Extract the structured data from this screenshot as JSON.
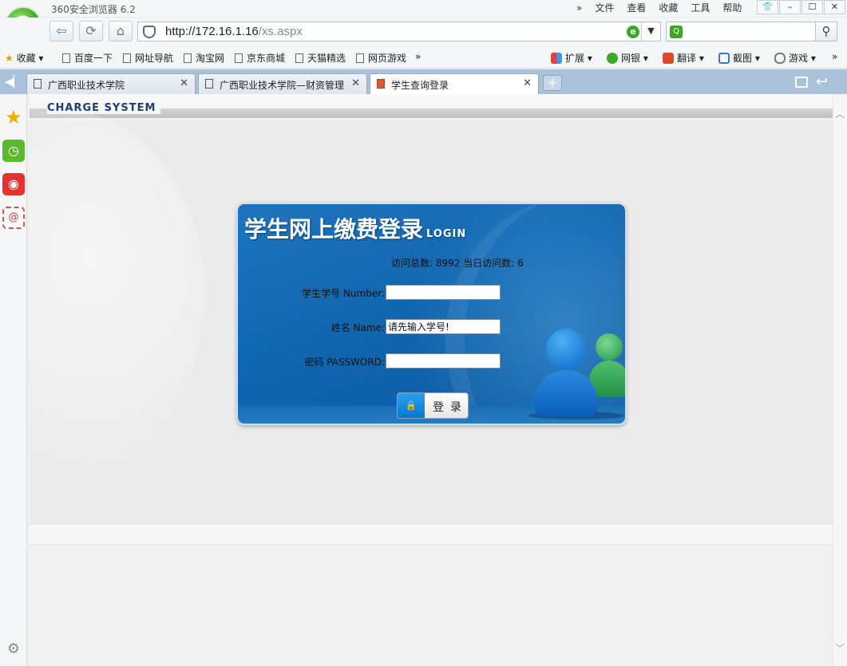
{
  "window": {
    "title": "360安全浏览器 6.2",
    "menu": [
      "文件",
      "查看",
      "收藏",
      "工具",
      "帮助"
    ]
  },
  "nav": {
    "url_host": "http://172.16.1.16",
    "url_path": "/xs.aspx"
  },
  "bookmarks": {
    "favorites_label": "收藏",
    "items": [
      "百度一下",
      "网址导航",
      "淘宝网",
      "京东商城",
      "天猫精选",
      "网页游戏"
    ],
    "tools": [
      "扩展",
      "网银",
      "翻译",
      "截图",
      "游戏"
    ]
  },
  "tabs": [
    {
      "label": "广西职业技术学院",
      "active": false
    },
    {
      "label": "广西职业技术学院—财资管理",
      "active": false
    },
    {
      "label": "学生查询登录",
      "active": true
    }
  ],
  "page": {
    "system_title": "CHARGE SYSTEM",
    "login": {
      "heading": "学生网上缴费登录",
      "heading_suffix": "LOGIN",
      "stats": "访问总数: 8992 当日访问数: 6",
      "student_number_label": "学生学号 Number:",
      "student_number_value": "",
      "name_label": "姓名 Name:",
      "name_value": "请先输入学号!",
      "password_label": "密码 PASSWORD:",
      "password_value": "",
      "submit_label": "登录"
    }
  },
  "colors": {
    "panel_blue": "#1166b0",
    "brand_green": "#3aa820",
    "tabbar": "#a9c1d9"
  }
}
